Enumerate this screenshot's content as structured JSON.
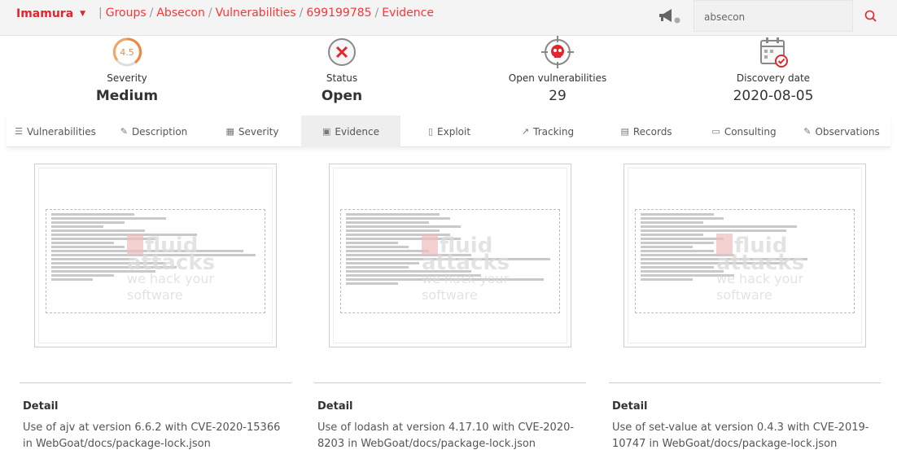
{
  "navbar": {
    "user": "Imamura",
    "breadcrumbs": [
      "Groups",
      "Absecon",
      "Vulnerabilities",
      "699199785",
      "Evidence"
    ],
    "search_value": "absecon",
    "icons": {
      "notifications": "megaphone-icon",
      "search": "search-icon"
    }
  },
  "indicators": [
    {
      "label": "Severity",
      "value": "Medium",
      "gauge": "4.5",
      "icon": "severity-gauge-icon"
    },
    {
      "label": "Status",
      "value": "Open",
      "icon": "close-circle-icon"
    },
    {
      "label": "Open vulnerabilities",
      "value": "29",
      "icon": "skull-target-icon"
    },
    {
      "label": "Discovery date",
      "value": "2020-08-05",
      "icon": "calendar-check-icon"
    }
  ],
  "tabs": [
    {
      "label": "Vulnerabilities",
      "icon": "list-icon"
    },
    {
      "label": "Description",
      "icon": "edit-icon"
    },
    {
      "label": "Severity",
      "icon": "calculator-icon"
    },
    {
      "label": "Evidence",
      "icon": "image-icon",
      "active": true
    },
    {
      "label": "Exploit",
      "icon": "file-icon"
    },
    {
      "label": "Tracking",
      "icon": "chart-line-icon"
    },
    {
      "label": "Records",
      "icon": "table-icon"
    },
    {
      "label": "Consulting",
      "icon": "comment-icon"
    },
    {
      "label": "Observations",
      "icon": "edit-icon"
    }
  ],
  "evidence": [
    {
      "title": "Detail",
      "description": "Use of ajv at version 6.6.2 with CVE-2020-15366 in WebGoat/docs/package-lock.json",
      "watermark": "fluid attacks",
      "watermark_sub": "we hack your software"
    },
    {
      "title": "Detail",
      "description": "Use of lodash at version 4.17.10 with CVE-2020-8203 in WebGoat/docs/package-lock.json",
      "watermark": "fluid attacks",
      "watermark_sub": "we hack your software"
    },
    {
      "title": "Detail",
      "description": "Use of set-value at version 0.4.3 with CVE-2019-10747 in WebGoat/docs/package-lock.json",
      "watermark": "fluid attacks",
      "watermark_sub": "we hack your software"
    }
  ],
  "colors": {
    "accent": "#e0262f",
    "link": "#ff3435"
  }
}
